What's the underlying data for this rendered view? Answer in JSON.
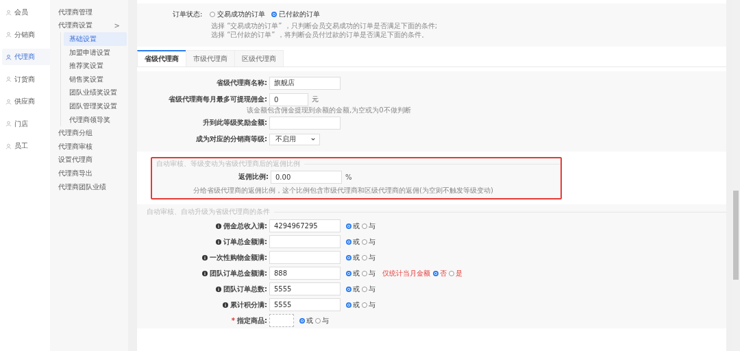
{
  "nav": {
    "items": [
      {
        "label": "会员",
        "selected": false
      },
      {
        "label": "分销商",
        "selected": false
      },
      {
        "label": "代理商",
        "selected": true
      },
      {
        "label": "订货商",
        "selected": false
      },
      {
        "label": "供应商",
        "selected": false
      },
      {
        "label": "门店",
        "selected": false
      },
      {
        "label": "员工",
        "selected": false
      }
    ]
  },
  "subnav": {
    "items": [
      {
        "label": "代理商管理"
      },
      {
        "label": "代理商设置",
        "toggle": ">",
        "children": [
          {
            "label": "基础设置",
            "selected": true
          },
          {
            "label": "加盟申请设置",
            "selected": false
          },
          {
            "label": "推荐奖设置",
            "selected": false
          },
          {
            "label": "销售奖设置",
            "selected": false
          },
          {
            "label": "团队业绩奖设置",
            "selected": false
          },
          {
            "label": "团队管理奖设置",
            "selected": false
          },
          {
            "label": "代理商领导奖",
            "selected": false
          }
        ]
      },
      {
        "label": "代理商分组"
      },
      {
        "label": "代理商审核"
      },
      {
        "label": "设置代理商"
      },
      {
        "label": "代理商导出"
      },
      {
        "label": "代理商团队业绩"
      }
    ]
  },
  "order_status": {
    "label": "订单状态:",
    "options": [
      {
        "label": "交易成功的订单",
        "selected": false
      },
      {
        "label": "已付款的订单",
        "selected": true
      }
    ],
    "hints": [
      "选择 “交易成功的订单” ，只判断会员交易成功的订单是否满足下面的条件;",
      "选择 “已付款的订单” ，将判断会员付过款的订单是否满足下面的条件。"
    ]
  },
  "tabs": [
    {
      "label": "省级代理商",
      "selected": true
    },
    {
      "label": "市级代理商",
      "selected": false
    },
    {
      "label": "区级代理商",
      "selected": false
    }
  ],
  "basic_form": {
    "fields": [
      {
        "kind": "input",
        "label": "省级代理商名称:",
        "value": "旗舰店"
      },
      {
        "kind": "input",
        "label": "省级代理商每月最多可提现佣金:",
        "value": "0",
        "unit": "元",
        "hint": "该金额包含佣金提现到余额的金额,为空或为0不做判断"
      },
      {
        "kind": "input",
        "label": "升到此等级奖励金额:"
      },
      {
        "kind": "select",
        "label": "成为对应的分销商等级:",
        "value": "不启用"
      }
    ]
  },
  "commission_section": {
    "highlighted": true,
    "legend": "自动审核、等级变动为省级代理商后的返佣比例",
    "field": {
      "label": "返佣比例:",
      "value": "0.00",
      "unit": "%"
    },
    "hint": "分给省级代理商的返佣比例，这个比例包含市级代理商和区级代理商的返佣(为空则不触发等级变动)"
  },
  "upgrade_section": {
    "legend": "自动审核、自动升级为省级代理商的条件",
    "rows": [
      {
        "kind": "input",
        "label": "佣金总收入满:",
        "info": true,
        "value": "4294967295",
        "options": [
          {
            "label": "或",
            "selected": true
          },
          {
            "label": "与",
            "selected": false
          }
        ]
      },
      {
        "kind": "input",
        "label": "订单总金额满:",
        "info": true,
        "options": [
          {
            "label": "或",
            "selected": true
          },
          {
            "label": "与",
            "selected": false
          }
        ]
      },
      {
        "kind": "input",
        "label": "一次性购物金额满:",
        "info": true,
        "options": [
          {
            "label": "或",
            "selected": true
          },
          {
            "label": "与",
            "selected": false
          }
        ]
      },
      {
        "kind": "input",
        "label": "团队订单总金额满:",
        "info": true,
        "value": "888",
        "options": [
          {
            "label": "或",
            "selected": true
          },
          {
            "label": "与",
            "selected": false
          }
        ],
        "extra": {
          "label": "仅统计当月金额",
          "options": [
            {
              "label": "否",
              "selected": true
            },
            {
              "label": "是",
              "selected": false
            }
          ]
        }
      },
      {
        "kind": "input",
        "label": "团队订单总数:",
        "info": true,
        "value": "5555",
        "options": [
          {
            "label": "或",
            "selected": true
          },
          {
            "label": "与",
            "selected": false
          }
        ]
      },
      {
        "kind": "input",
        "label": "累计积分满:",
        "info": true,
        "value": "5555",
        "options": [
          {
            "label": "或",
            "selected": true
          },
          {
            "label": "与",
            "selected": false
          }
        ]
      },
      {
        "kind": "picker",
        "label": "指定商品:",
        "required": true,
        "mark": "*",
        "options": [
          {
            "label": "或",
            "selected": true
          },
          {
            "label": "与",
            "selected": false
          }
        ]
      }
    ]
  }
}
